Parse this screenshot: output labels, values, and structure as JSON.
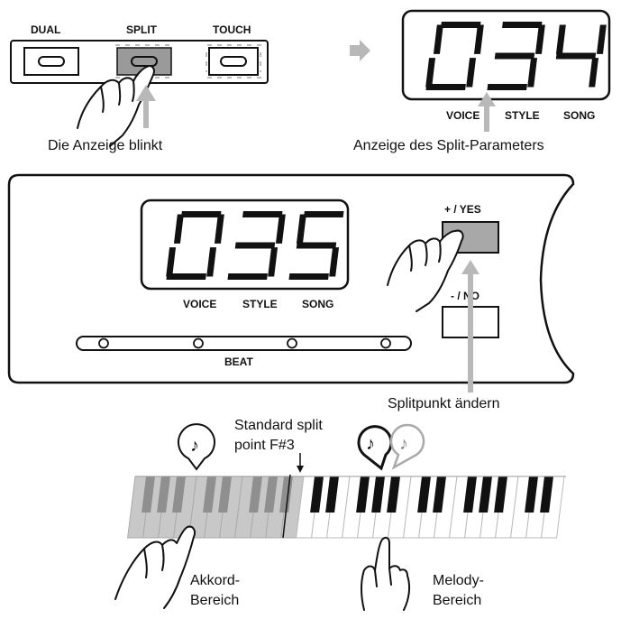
{
  "buttons_panel": {
    "dual_label": "DUAL",
    "split_label": "SPLIT",
    "touch_label": "TOUCH",
    "caption": "Die Anzeige blinkt"
  },
  "display_top": {
    "value": "034",
    "labels": [
      "VOICE",
      "STYLE",
      "SONG"
    ],
    "caption": "Anzeige des Split-Parameters"
  },
  "main_panel": {
    "value": "035",
    "labels": [
      "VOICE",
      "STYLE",
      "SONG"
    ],
    "beat_label": "BEAT",
    "yes_label": "+ / YES",
    "no_label": "- / NO",
    "caption": "Splitpunkt ändern"
  },
  "keyboard": {
    "split_point_line1": "Standard split",
    "split_point_line2": "point F#3",
    "left_zone_line1": "Akkord-",
    "left_zone_line2": "Bereich",
    "right_zone_line1": "Melody-",
    "right_zone_line2": "Bereich",
    "note_symbol": "♪"
  },
  "colors": {
    "button_active": "#9a9a9a",
    "yes_button": "#a8a8a8",
    "arrow": "#b8b8b8",
    "left_keys": "#c8c8c8",
    "outline": "#111111"
  }
}
